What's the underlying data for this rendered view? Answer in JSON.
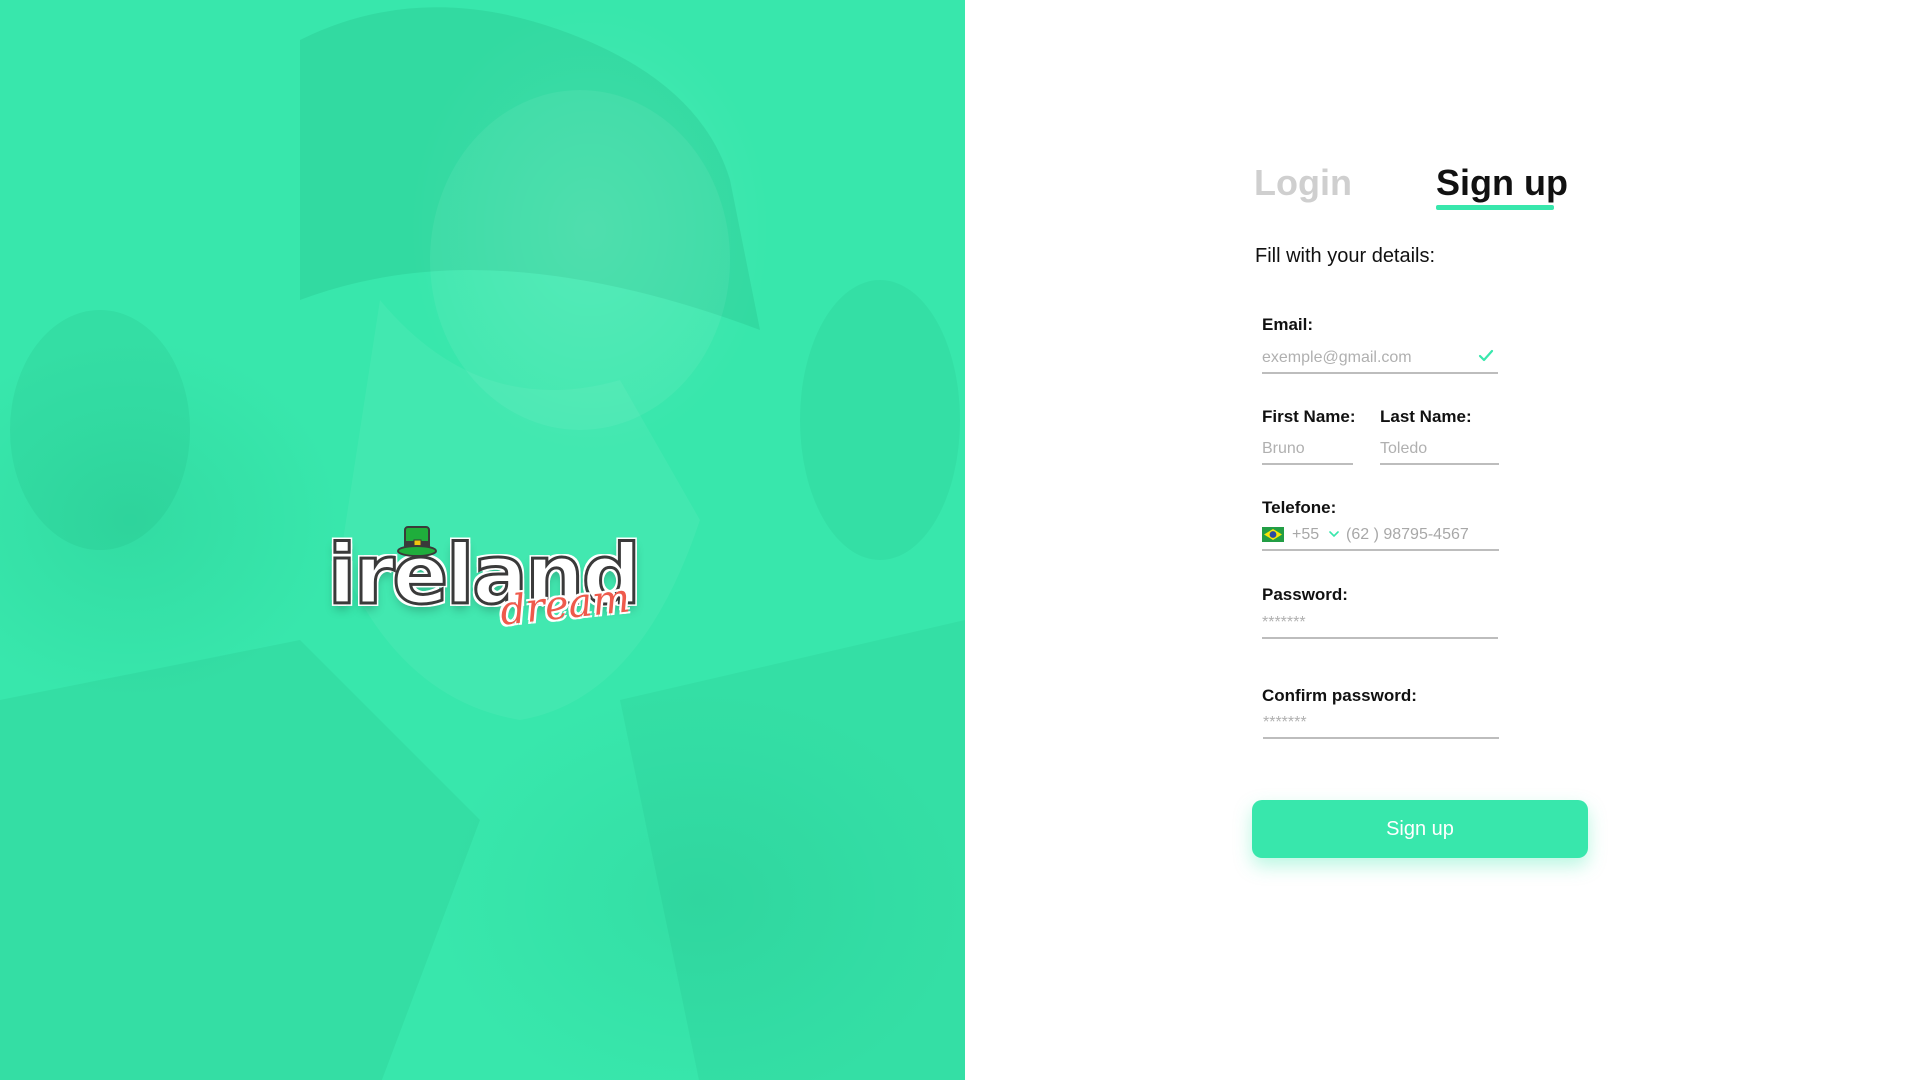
{
  "colors": {
    "accent": "#38e7ac",
    "tab_inactive": "#cfcfcf",
    "text": "#111111",
    "placeholder": "#b0b0b0",
    "logo_script": "#ef5a4c"
  },
  "hero": {
    "logo": {
      "word": "ireland",
      "script": "dream"
    }
  },
  "tabs": {
    "login_label": "Login",
    "signup_label": "Sign up",
    "active": "signup"
  },
  "form": {
    "subtitle": "Fill with your details:",
    "email": {
      "label": "Email:",
      "placeholder": "exemple@gmail.com",
      "status_icon": "check-icon"
    },
    "first_name": {
      "label": "First Name:",
      "placeholder": "Bruno"
    },
    "last_name": {
      "label": "Last Name:",
      "placeholder": "Toledo"
    },
    "telefone": {
      "label": "Telefone:",
      "flag_icon": "brazil-flag-icon",
      "dial_code": "+55",
      "placeholder": "(62 ) 98795-4567"
    },
    "password": {
      "label": "Password:",
      "placeholder": "*******"
    },
    "confirm_password": {
      "label": "Confirm password:",
      "placeholder": "*******"
    },
    "submit_label": "Sign up"
  }
}
